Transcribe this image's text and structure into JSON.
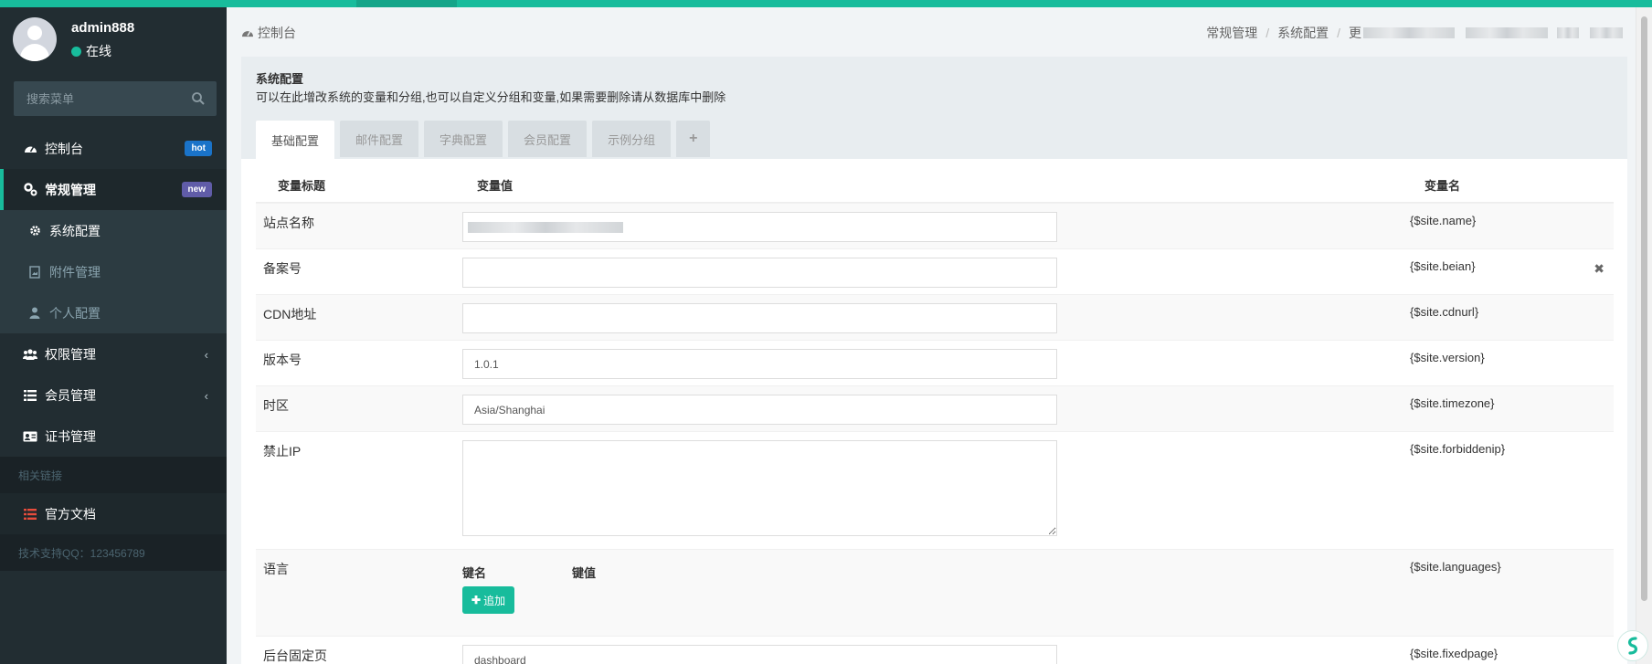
{
  "colors": {
    "accent": "#18bc9c",
    "sidebar_bg": "#222d32",
    "hot": "#1a73c9",
    "new": "#605ca8",
    "danger": "#e74c3c"
  },
  "user": {
    "name": "admin888",
    "status": "在线"
  },
  "search": {
    "placeholder": "搜索菜单"
  },
  "menu": {
    "dashboard": {
      "label": "控制台",
      "badge": "hot",
      "icon": "dashboard-icon"
    },
    "general": {
      "label": "常规管理",
      "badge": "new",
      "icon": "cogs-icon"
    },
    "sub": [
      {
        "label": "系统配置",
        "icon": "gear-icon"
      },
      {
        "label": "附件管理",
        "icon": "file-image-icon"
      },
      {
        "label": "个人配置",
        "icon": "user-icon"
      }
    ],
    "auth": {
      "label": "权限管理",
      "icon": "group-icon"
    },
    "member": {
      "label": "会员管理",
      "icon": "list-icon"
    },
    "cert": {
      "label": "证书管理",
      "icon": "id-card-icon"
    },
    "links_header": "相关链接",
    "docs": {
      "label": "官方文档",
      "icon": "list-icon"
    },
    "support": "技术支持QQ：123456789"
  },
  "breadcrumb": {
    "home": "控制台",
    "items": [
      "常规管理",
      "系统配置"
    ],
    "tail": "更"
  },
  "panel": {
    "title": "系统配置",
    "description": "可以在此增改系统的变量和分组,也可以自定义分组和变量,如果需要删除请从数据库中删除",
    "tabs": [
      "基础配置",
      "邮件配置",
      "字典配置",
      "会员配置",
      "示例分组"
    ],
    "add_tab": "+"
  },
  "table": {
    "headers": [
      "变量标题",
      "变量值",
      "变量名"
    ],
    "rows": [
      {
        "title": "站点名称",
        "value": "",
        "var": "{$site.name}"
      },
      {
        "title": "备案号",
        "value": "",
        "var": "{$site.beian}"
      },
      {
        "title": "CDN地址",
        "value": "",
        "var": "{$site.cdnurl}"
      },
      {
        "title": "版本号",
        "value": "1.0.1",
        "var": "{$site.version}"
      },
      {
        "title": "时区",
        "value": "Asia/Shanghai",
        "var": "{$site.timezone}"
      },
      {
        "title": "禁止IP",
        "value": "",
        "var": "{$site.forbiddenip}"
      },
      {
        "title": "语言",
        "var": "{$site.languages}",
        "key_header": "键名",
        "val_header": "键值",
        "add_label": "追加"
      },
      {
        "title": "后台固定页",
        "value": "dashboard",
        "var": "{$site.fixedpage}"
      }
    ]
  }
}
